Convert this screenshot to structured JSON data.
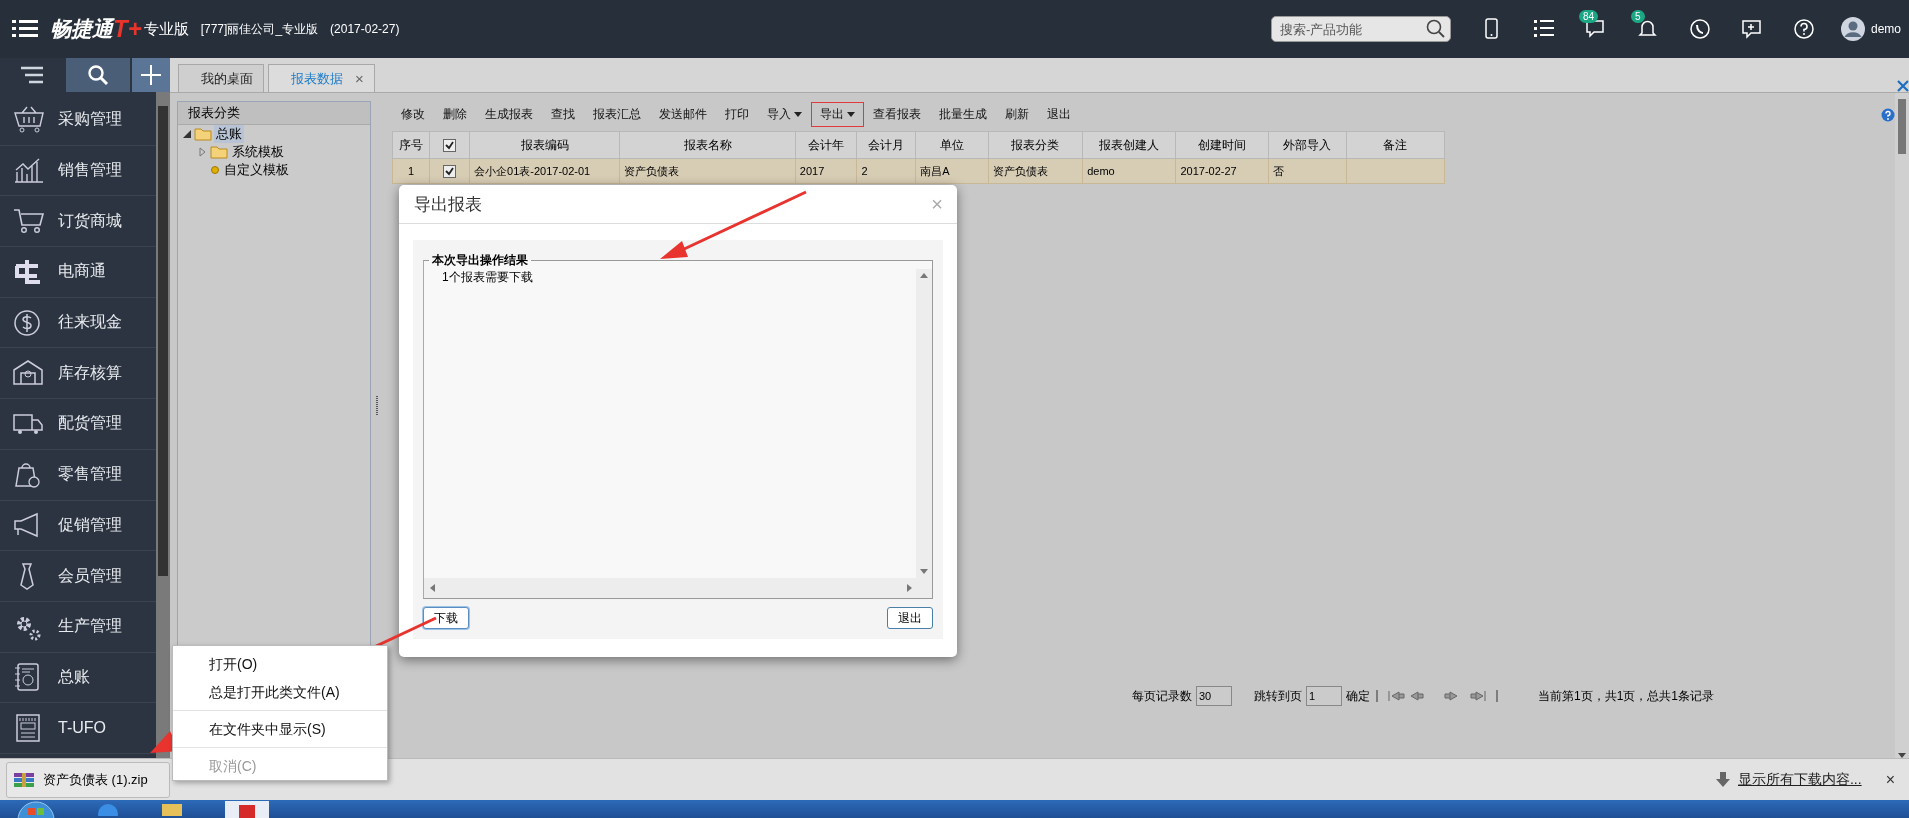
{
  "topbar": {
    "brand": "畅捷通",
    "brand_mark": "T+",
    "edition": "专业版",
    "company": "[777]丽佳公司_专业版",
    "date": "(2017-02-27)",
    "search": {
      "placeholder": "搜索-产品功能"
    },
    "badges": [
      "84",
      "5"
    ],
    "user": "demo"
  },
  "tabs": [
    {
      "label": "我的桌面",
      "selected": false
    },
    {
      "label": "报表数据",
      "selected": true,
      "close": "×"
    }
  ],
  "sidebar": {
    "items": [
      {
        "label": "采购管理"
      },
      {
        "label": "销售管理"
      },
      {
        "label": "订货商城"
      },
      {
        "label": "电商通"
      },
      {
        "label": "往来现金"
      },
      {
        "label": "库存核算"
      },
      {
        "label": "配货管理"
      },
      {
        "label": "零售管理"
      },
      {
        "label": "促销管理"
      },
      {
        "label": "会员管理"
      },
      {
        "label": "生产管理"
      },
      {
        "label": "总账"
      },
      {
        "label": "T-UFO"
      }
    ]
  },
  "tree": {
    "title": "报表分类",
    "nodes": [
      {
        "label": "总账",
        "kind": "folder",
        "expanded": true,
        "selected": true,
        "children": [
          {
            "label": "系统模板",
            "kind": "folder",
            "expanded": false,
            "selected": false
          },
          {
            "label": "自定义模板",
            "kind": "leaf",
            "selected": false
          }
        ]
      }
    ]
  },
  "toolbar": [
    {
      "label": "修改",
      "dropdown": false,
      "highlighted": false
    },
    {
      "label": "删除",
      "dropdown": false,
      "highlighted": false
    },
    {
      "label": "生成报表",
      "dropdown": false,
      "highlighted": false
    },
    {
      "label": "查找",
      "dropdown": false,
      "highlighted": false
    },
    {
      "label": "报表汇总",
      "dropdown": false,
      "highlighted": false
    },
    {
      "label": "发送邮件",
      "dropdown": false,
      "highlighted": false
    },
    {
      "label": "打印",
      "dropdown": false,
      "highlighted": false
    },
    {
      "label": "导入",
      "dropdown": true,
      "highlighted": false
    },
    {
      "label": "导出",
      "dropdown": true,
      "highlighted": true
    },
    {
      "label": "查看报表",
      "dropdown": false,
      "highlighted": false
    },
    {
      "label": "批量生成",
      "dropdown": false,
      "highlighted": false
    },
    {
      "label": "刷新",
      "dropdown": false,
      "highlighted": false
    },
    {
      "label": "退出",
      "dropdown": false,
      "highlighted": false
    }
  ],
  "table": {
    "columns": [
      "序号",
      "",
      "报表编码",
      "报表名称",
      "会计年",
      "会计月",
      "单位",
      "报表分类",
      "报表创建人",
      "创建时间",
      "外部导入",
      "备注"
    ],
    "header_checked": true,
    "rows": [
      {
        "selected": true,
        "checked": true,
        "cells": [
          "1",
          "",
          "会小企01表-2017-02-01",
          "资产负债表",
          "2017",
          "2",
          "南昌A",
          "资产负债表",
          "demo",
          "2017-02-27",
          "否",
          ""
        ]
      }
    ]
  },
  "pagination": {
    "page_size_label": "每页记录数",
    "page_size": "30",
    "jump_label": "跳转到页",
    "page": "1",
    "confirm": "确定",
    "summary": "当前第1页，共1页，总共1条记录"
  },
  "dialog": {
    "title": "导出报表",
    "close": "×",
    "group_title": "本次导出操作结果",
    "message": "1个报表需要下载",
    "buttons": [
      {
        "label": "下载",
        "focused": true
      },
      {
        "label": "退出",
        "focused": false
      }
    ]
  },
  "context_menu": [
    {
      "label": "打开(O)",
      "disabled": false,
      "separator_before": false
    },
    {
      "label": "总是打开此类文件(A)",
      "disabled": false,
      "separator_before": false
    },
    {
      "label": "在文件夹中显示(S)",
      "disabled": false,
      "separator_before": true
    },
    {
      "label": "取消(C)",
      "disabled": true,
      "separator_before": true
    }
  ],
  "download_bar": {
    "file": "资产负债表 (1).zip",
    "show_all": "显示所有下载内容...",
    "close": "×"
  }
}
